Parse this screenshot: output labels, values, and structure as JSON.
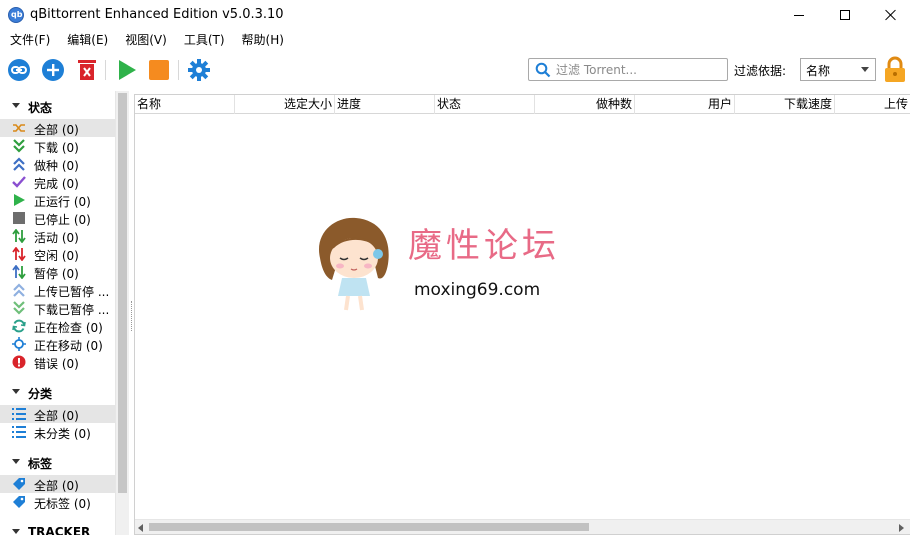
{
  "window": {
    "title": "qBittorrent Enhanced Edition v5.0.3.10"
  },
  "menubar": {
    "items": [
      "文件(F)",
      "编辑(E)",
      "视图(V)",
      "工具(T)",
      "帮助(H)"
    ]
  },
  "toolbar": {
    "search_placeholder": "过滤 Torrent...",
    "filter_label": "过滤依据:",
    "filter_value": "名称",
    "icons": [
      "add-link-icon",
      "add-torrent-icon",
      "delete-torrent-icon",
      "start-icon",
      "stop-icon",
      "options-icon",
      "lock-icon"
    ]
  },
  "sidebar": {
    "sections": {
      "status": "状态",
      "categories": "分类",
      "tags": "标签",
      "trackers": "TRACKER"
    },
    "status_items": [
      {
        "label": "全部 (0)",
        "icon": "shuffle-icon"
      },
      {
        "label": "下载 (0)",
        "icon": "download-icon"
      },
      {
        "label": "做种 (0)",
        "icon": "seeding-icon"
      },
      {
        "label": "完成 (0)",
        "icon": "checkmark-icon"
      },
      {
        "label": "正运行 (0)",
        "icon": "running-icon"
      },
      {
        "label": "已停止 (0)",
        "icon": "stopped-icon"
      },
      {
        "label": "活动 (0)",
        "icon": "active-icon"
      },
      {
        "label": "空闲 (0)",
        "icon": "inactive-icon"
      },
      {
        "label": "暂停 (0)",
        "icon": "stalled-icon"
      },
      {
        "label": "上传已暂停 ...",
        "icon": "upload-stalled-icon"
      },
      {
        "label": "下载已暂停 ...",
        "icon": "download-stalled-icon"
      },
      {
        "label": "正在检查 (0)",
        "icon": "checking-icon"
      },
      {
        "label": "正在移动 (0)",
        "icon": "moving-icon"
      },
      {
        "label": "错误 (0)",
        "icon": "error-icon"
      }
    ],
    "category_items": [
      {
        "label": "全部 (0)",
        "icon": "list-icon"
      },
      {
        "label": "未分类 (0)",
        "icon": "list-icon"
      }
    ],
    "tag_items": [
      {
        "label": "全部 (0)",
        "icon": "tag-icon"
      },
      {
        "label": "无标签 (0)",
        "icon": "tag-icon"
      }
    ]
  },
  "table": {
    "columns": [
      "名称",
      "选定大小",
      "进度",
      "状态",
      "做种数",
      "用户",
      "下载速度",
      "上传"
    ]
  },
  "watermark": {
    "title": "魔性论坛",
    "url": "moxing69.com"
  },
  "colors": {
    "accent_blue": "#1e7fd6",
    "green": "#2fb24a",
    "red": "#d9242b",
    "orange": "#f58b1f",
    "watermark_pink": "#e86a86"
  }
}
